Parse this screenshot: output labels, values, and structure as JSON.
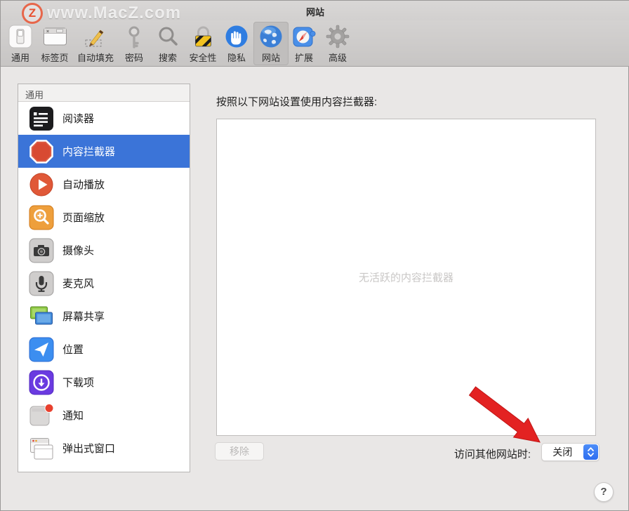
{
  "watermark": {
    "logo_letter": "Z",
    "text": "www.MacZ.com"
  },
  "window": {
    "title": "网站",
    "help_label": "?"
  },
  "toolbar": {
    "items": [
      {
        "label": "通用",
        "icon": "switch-icon",
        "selected": false
      },
      {
        "label": "标签页",
        "icon": "tabs-icon",
        "selected": false
      },
      {
        "label": "自动填充",
        "icon": "pencil-icon",
        "selected": false
      },
      {
        "label": "密码",
        "icon": "key-icon",
        "selected": false
      },
      {
        "label": "搜索",
        "icon": "magnifier-icon",
        "selected": false
      },
      {
        "label": "安全性",
        "icon": "padlock-icon",
        "selected": false
      },
      {
        "label": "隐私",
        "icon": "hand-icon",
        "selected": false
      },
      {
        "label": "网站",
        "icon": "globe-icon",
        "selected": true
      },
      {
        "label": "扩展",
        "icon": "puzzle-icon",
        "selected": false
      },
      {
        "label": "高级",
        "icon": "gear-icon",
        "selected": false
      }
    ]
  },
  "sidebar": {
    "header": "通用",
    "items": [
      {
        "label": "阅读器",
        "icon": "reader-icon",
        "selected": false
      },
      {
        "label": "内容拦截器",
        "icon": "stop-octagon-icon",
        "selected": true
      },
      {
        "label": "自动播放",
        "icon": "play-circle-icon",
        "selected": false
      },
      {
        "label": "页面缩放",
        "icon": "zoom-magnifier-icon",
        "selected": false
      },
      {
        "label": "摄像头",
        "icon": "camera-icon",
        "selected": false
      },
      {
        "label": "麦克风",
        "icon": "microphone-icon",
        "selected": false
      },
      {
        "label": "屏幕共享",
        "icon": "screens-icon",
        "selected": false
      },
      {
        "label": "位置",
        "icon": "location-arrow-icon",
        "selected": false
      },
      {
        "label": "下载项",
        "icon": "download-circle-icon",
        "selected": false
      },
      {
        "label": "通知",
        "icon": "notification-badge-icon",
        "selected": false
      },
      {
        "label": "弹出式窗口",
        "icon": "popup-windows-icon",
        "selected": false
      }
    ]
  },
  "main": {
    "heading": "按照以下网站设置使用内容拦截器:",
    "empty_message": "无活跃的内容拦截器",
    "remove_button": "移除",
    "other_websites_label": "访问其他网站时:",
    "other_websites_value": "关闭"
  },
  "colors": {
    "selection_blue": "#3b74d8",
    "popup_stepper_blue": "#3478f6",
    "annotation_arrow_red": "#e32222",
    "toolbar_selected_gray": "#c0bebd"
  }
}
